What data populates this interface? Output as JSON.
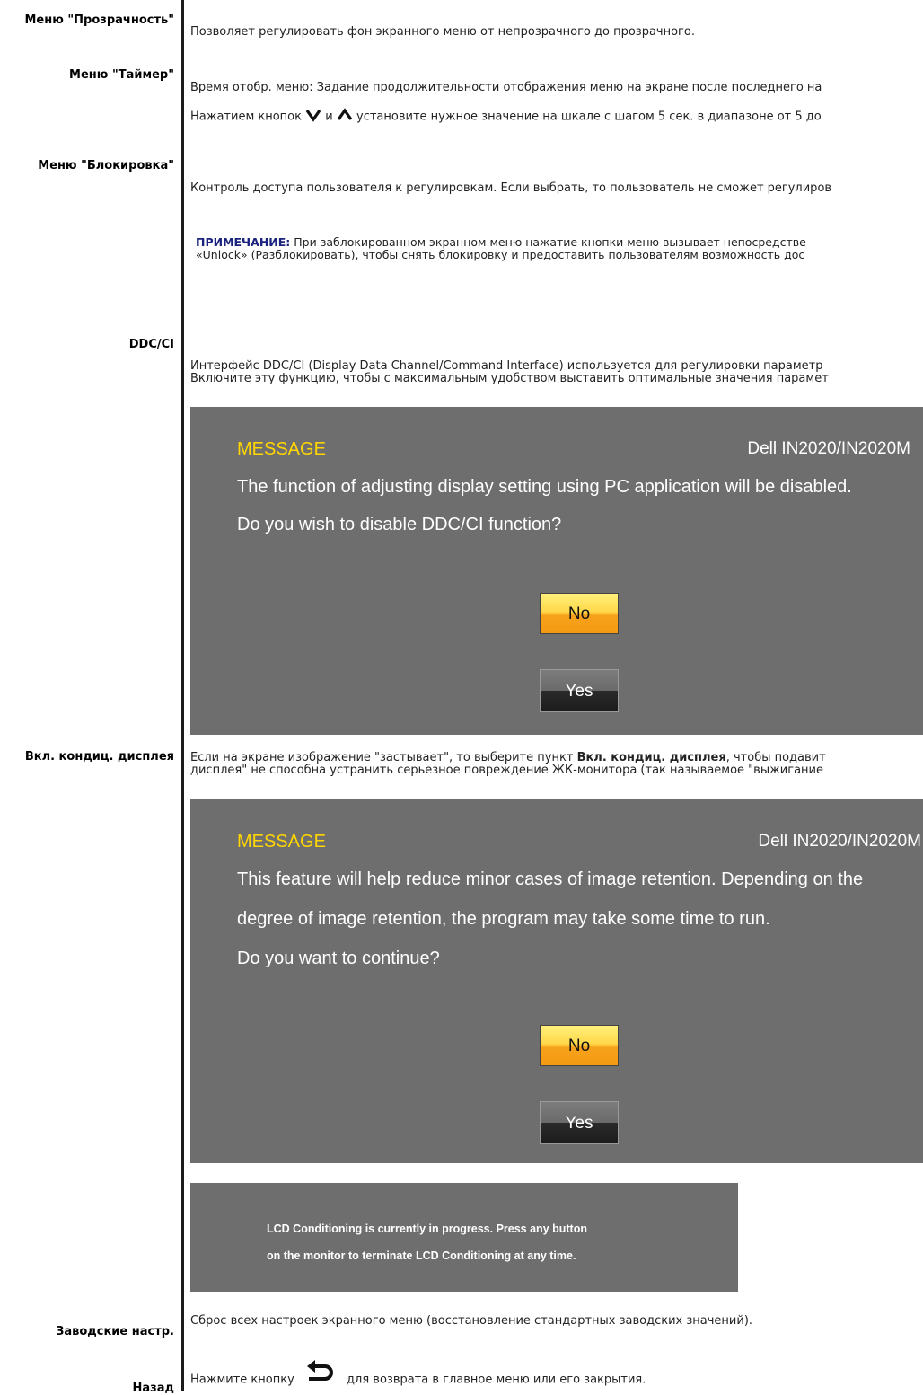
{
  "rows": {
    "transparency": {
      "label": "Меню \"Прозрачность\"",
      "text": "Позволяет регулировать фон экранного меню от непрозрачного до прозрачного."
    },
    "timer": {
      "label": "Меню \"Таймер\"",
      "text1": "Время отобр. меню: Задание продолжительности отображения меню на экране после последнего на",
      "text2_pre": "Нажатием кнопок",
      "text2_mid": "и",
      "text2_post": "установите нужное значение на шкале с шагом 5 сек. в диапазоне от 5 до"
    },
    "lock": {
      "label": "Меню \"Блокировка\"",
      "text": "Контроль доступа пользователя к регулировкам. Если выбрать, то пользователь не сможет регулиров",
      "note_key": "ПРИМЕЧАНИЕ:",
      "note_text": " При заблокированном экранном меню нажатие кнопки меню вызывает непосредстве",
      "note_text2": "«Unlock» (Разблокировать), чтобы снять блокировку и предоставить пользователям возможность дос"
    },
    "ddcci": {
      "label": "DDC/CI",
      "text1": "Интерфейс DDC/CI (Display Data Channel/Command Interface) используется для регулировки параметр",
      "text2": "Включите эту функцию, чтобы с максимальным удобством выставить оптимальные значения парамет"
    },
    "conditioning": {
      "label": "Вкл. кондиц. дисплея",
      "text1_pre": "Если на экране изображение \"застывает\", то выберите пункт ",
      "text1_bold": "Вкл. кондиц. дисплея",
      "text1_post": ", чтобы подавит",
      "text2": "дисплея\" не способна устранить серьезное повреждение ЖК-монитора (так называемое \"выжигание"
    },
    "factory": {
      "label": "Заводские настр",
      "label_suffix": ".",
      "text": "Сброс всех настроек экранного меню (восстановление стандартных заводских значений)."
    },
    "back": {
      "label": "Назад",
      "text_pre": "Нажмите кнопку",
      "text_post": "для возврата в главное меню или его закрытия."
    }
  },
  "osd_ddcci": {
    "title": "MESSAGE",
    "model": "Dell IN2020/IN2020M",
    "line1": "The function of adjusting display setting using PC application will be disabled.",
    "line2": "Do you wish to disable DDC/CI function?",
    "no": "No",
    "yes": "Yes"
  },
  "osd_conditioning": {
    "title": "MESSAGE",
    "model": "Dell IN2020/IN2020M",
    "line1": "This feature will help reduce minor cases of image retention. Depending on the",
    "line2": "degree of image retention, the program may take some time to run.",
    "line3": "Do you want to continue?",
    "no": "No",
    "yes": "Yes"
  },
  "conditioning_progress": {
    "line1": "LCD Conditioning is currently in progress. Press any button",
    "line2": "on the monitor to terminate LCD Conditioning at any time."
  },
  "icons": {
    "down": "chevron-down-icon",
    "up": "chevron-up-icon",
    "back": "back-arrow-icon"
  },
  "colors": {
    "osd_bg": "#6e6e6e",
    "osd_title": "#ffd600",
    "note_key": "#1a237e"
  }
}
